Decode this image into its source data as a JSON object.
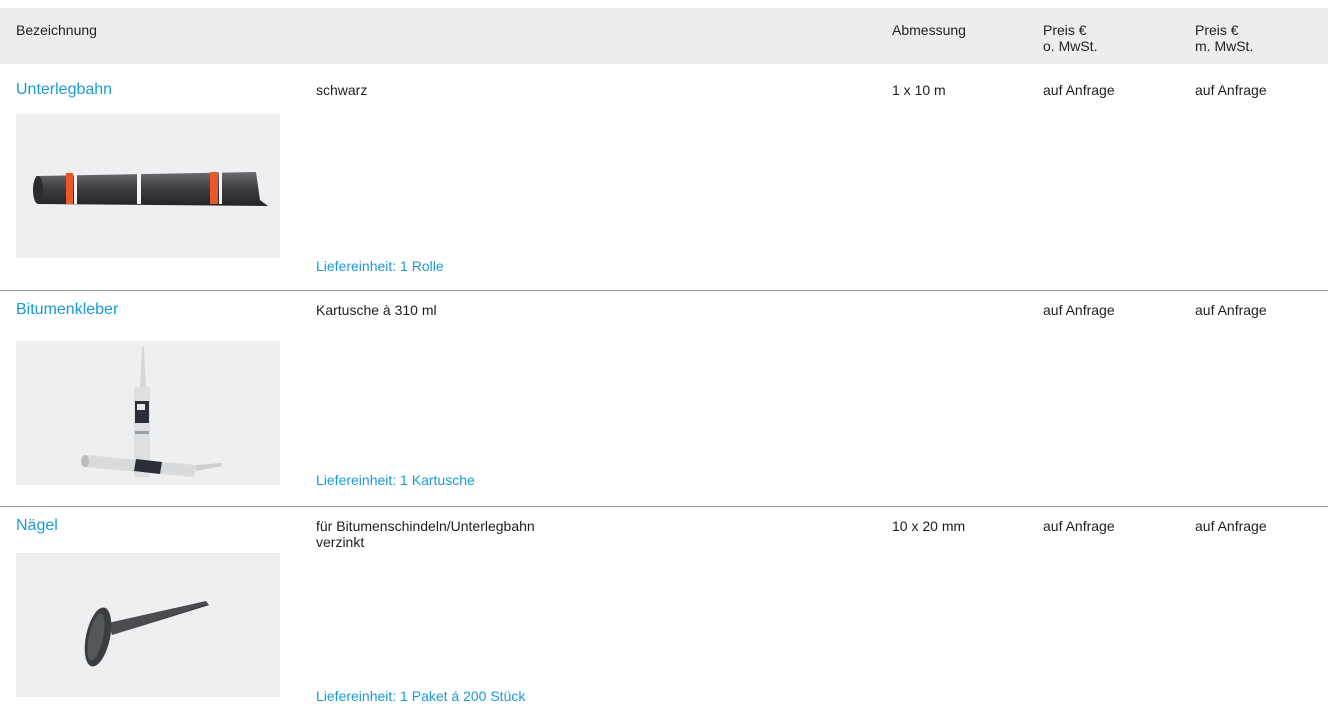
{
  "header": {
    "bezeichnung": "Bezeichnung",
    "abmessung": "Abmessung",
    "preis_netto_line1": "Preis €",
    "preis_netto_line2": "o. MwSt.",
    "preis_brutto_line1": "Preis €",
    "preis_brutto_line2": "m. MwSt."
  },
  "products": [
    {
      "name": "Unterlegbahn",
      "description": "schwarz",
      "dimension": "1 x 10 m",
      "price_net": "auf Anfrage",
      "price_gross": "auf Anfrage",
      "delivery_unit": "Liefereinheit: 1 Rolle",
      "image_icon": "roofing-felt-roll-icon"
    },
    {
      "name": "Bitumenkleber",
      "description": "Kartusche à 310 ml",
      "dimension": "",
      "price_net": "auf Anfrage",
      "price_gross": "auf Anfrage",
      "delivery_unit": "Liefereinheit: 1 Kartusche",
      "image_icon": "adhesive-cartridge-icon"
    },
    {
      "name": "Nägel",
      "description": "für Bitumenschindeln/Unterlegbahn\nverzinkt",
      "dimension": "10 x 20 mm",
      "price_net": "auf Anfrage",
      "price_gross": "auf Anfrage",
      "delivery_unit": "Liefereinheit: 1 Paket á 200 Stück",
      "image_icon": "roofing-nail-icon"
    }
  ],
  "colors": {
    "accent": "#1a9ad6",
    "header_bg": "#ededed",
    "photo_bg": "#eeeff0",
    "divider": "#9a9a9a"
  }
}
